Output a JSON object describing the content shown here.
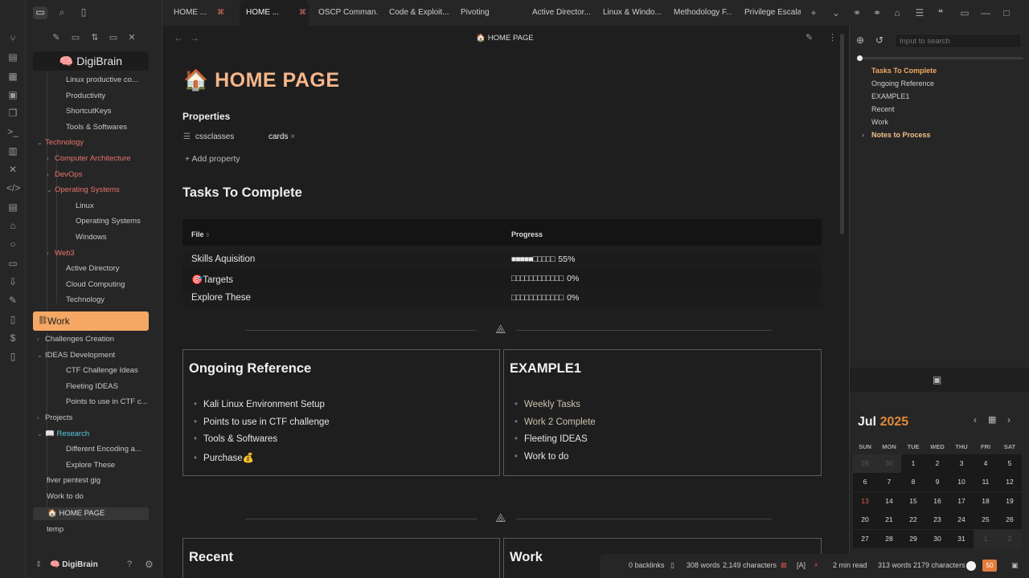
{
  "app": {
    "vault_name": "DigiBrain",
    "vault_emoji": "🧠"
  },
  "tabs": [
    {
      "label": "HOME ...",
      "active": false
    },
    {
      "label": "HOME ...",
      "active": true
    },
    {
      "label": "OSCP Comman...",
      "active": false
    },
    {
      "label": "Code & Exploit...",
      "active": false
    },
    {
      "label": "Pivoting",
      "active": false
    },
    {
      "label": "Active Director...",
      "active": false
    },
    {
      "label": "Linux & Windo...",
      "active": false
    },
    {
      "label": "Methodology F...",
      "active": false
    },
    {
      "label": "Privilege Escala...",
      "active": false
    }
  ],
  "sidebar": {
    "tree": [
      {
        "label": "Linux productive co...",
        "level": 2,
        "style": "",
        "caret": ""
      },
      {
        "label": "Productivity",
        "level": 2,
        "style": "",
        "caret": ""
      },
      {
        "label": "ShortcutKeys",
        "level": 2,
        "style": "",
        "caret": ""
      },
      {
        "label": "Tools & Softwares",
        "level": 2,
        "style": "",
        "caret": ""
      },
      {
        "label": "Technology",
        "level": 1,
        "style": "red",
        "caret": "⌄"
      },
      {
        "label": "Computer Architecture",
        "level": 2,
        "style": "red",
        "caret": "›"
      },
      {
        "label": "DevOps",
        "level": 2,
        "style": "red",
        "caret": "›"
      },
      {
        "label": "Operating Systems",
        "level": 2,
        "style": "red",
        "caret": "⌄"
      },
      {
        "label": "Linux",
        "level": 3,
        "style": "",
        "caret": ""
      },
      {
        "label": "Operating Systems",
        "level": 3,
        "style": "",
        "caret": ""
      },
      {
        "label": "Windows",
        "level": 3,
        "style": "",
        "caret": ""
      },
      {
        "label": "Web3",
        "level": 2,
        "style": "red",
        "caret": "›"
      },
      {
        "label": "Active Directory",
        "level": 2,
        "style": "",
        "caret": ""
      },
      {
        "label": "Cloud Computing",
        "level": 2,
        "style": "",
        "caret": ""
      },
      {
        "label": "Technology",
        "level": 2,
        "style": "",
        "caret": ""
      }
    ],
    "work_label": "Work",
    "tree2": [
      {
        "label": "Challenges Creation",
        "level": 1,
        "style": "",
        "caret": "›"
      },
      {
        "label": "IDEAS Development",
        "level": 1,
        "style": "",
        "caret": "⌄"
      },
      {
        "label": "CTF Challenge Ideas",
        "level": 2,
        "style": "",
        "caret": ""
      },
      {
        "label": "Fleeting IDEAS",
        "level": 2,
        "style": "",
        "caret": ""
      },
      {
        "label": "Points to use in CTF c...",
        "level": 2,
        "style": "",
        "caret": ""
      },
      {
        "label": "Projects",
        "level": 1,
        "style": "",
        "caret": "›"
      },
      {
        "label": "📖 Research",
        "level": 1,
        "style": "cyan",
        "caret": "⌄"
      },
      {
        "label": "Different Encoding a...",
        "level": 2,
        "style": "",
        "caret": ""
      },
      {
        "label": "Explore These",
        "level": 2,
        "style": "",
        "caret": ""
      },
      {
        "label": "fiver pentest gig",
        "level": 1,
        "style": "",
        "caret": ""
      },
      {
        "label": "Work to do",
        "level": 1,
        "style": "",
        "caret": ""
      }
    ],
    "home_label": "🏠 HOME PAGE",
    "temp_label": "temp"
  },
  "view": {
    "title": "🏠 HOME PAGE"
  },
  "page": {
    "title": "🏠 HOME PAGE",
    "properties_heading": "Properties",
    "prop_key": "cssclasses",
    "prop_value": "cards",
    "add_property": "+ Add property",
    "tasks_heading": "Tasks To Complete",
    "table": {
      "col_file": "File",
      "col_file_count": "3",
      "col_progress": "Progress",
      "rows": [
        {
          "file": "Skills Aquisition",
          "bar": "■■■■■□□□□□",
          "pct": "55%",
          "progress": 0.55
        },
        {
          "file": "🎯Targets",
          "bar": "□□□□□□□□□□□□",
          "pct": "0%",
          "progress": 0
        },
        {
          "file": "Explore These",
          "bar": "□□□□□□□□□□□□",
          "pct": "0%",
          "progress": 0
        }
      ]
    },
    "cards": [
      {
        "title": "Ongoing Reference",
        "items": [
          "Kali Linux Environment Setup",
          "Points to use in CTF challenge",
          "Tools & Softwares",
          "Purchase💰"
        ],
        "dim": [
          false,
          false,
          false,
          false
        ]
      },
      {
        "title": "EXAMPLE1",
        "items": [
          "Weekly Tasks",
          "Work 2 Complete",
          "Fleeting IDEAS",
          "Work to do"
        ],
        "dim": [
          true,
          true,
          false,
          false
        ]
      },
      {
        "title": "Recent",
        "items": [],
        "dim": []
      },
      {
        "title": "Work",
        "items": [],
        "dim": []
      }
    ]
  },
  "right": {
    "search_placeholder": "Input to search",
    "outline": [
      {
        "label": "Tasks To Complete",
        "hl": true
      },
      {
        "label": "Ongoing Reference",
        "hl": false
      },
      {
        "label": "EXAMPLE1",
        "hl": false
      },
      {
        "label": "Recent",
        "hl": false
      },
      {
        "label": "Work",
        "hl": false
      },
      {
        "label": "Notes to Process",
        "hl": true,
        "caret": "›"
      }
    ],
    "calendar": {
      "month": "Jul",
      "year": "2025",
      "dow": [
        "SUN",
        "MON",
        "TUE",
        "WED",
        "THU",
        "FRI",
        "SAT"
      ],
      "weeks": [
        [
          "29",
          "30",
          "1",
          "2",
          "3",
          "4",
          "5"
        ],
        [
          "6",
          "7",
          "8",
          "9",
          "10",
          "11",
          "12"
        ],
        [
          "13",
          "14",
          "15",
          "16",
          "17",
          "18",
          "19"
        ],
        [
          "20",
          "21",
          "22",
          "23",
          "24",
          "25",
          "26"
        ],
        [
          "27",
          "28",
          "29",
          "30",
          "31",
          "1",
          "2"
        ]
      ]
    }
  },
  "status": {
    "backlinks": "0 backlinks",
    "words": "308 words",
    "chars": "2,149 characters",
    "mode": "[A]",
    "read": "2 min read",
    "words2": "313 words 2179 characters",
    "badge": "50"
  },
  "colors": {
    "accent": "#f4a863",
    "folder_red": "#e8736a",
    "research_cyan": "#5ac8e0",
    "title_peach": "#f5b78a"
  }
}
